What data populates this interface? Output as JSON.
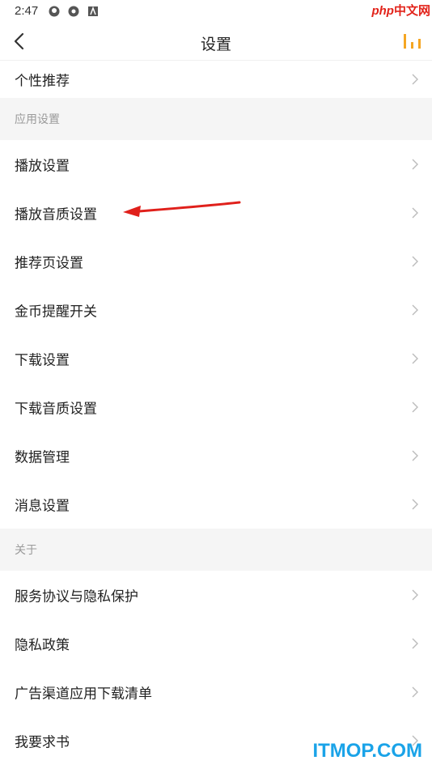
{
  "status_bar": {
    "time": "2:47",
    "icons": [
      "tencent-icon",
      "camera-aperture-icon",
      "a-box-icon"
    ]
  },
  "watermark_top": {
    "php": "php",
    "cn": "中文网"
  },
  "header": {
    "title": "设置",
    "back_icon": "chevron-left-icon",
    "right_icon": "equalizer-icon"
  },
  "list": {
    "top_item": "个性推荐",
    "section_app": "应用设置",
    "app_items": [
      "播放设置",
      "播放音质设置",
      "推荐页设置",
      "金币提醒开关",
      "下载设置",
      "下载音质设置",
      "数据管理",
      "消息设置"
    ],
    "section_about": "关于",
    "about_items": [
      "服务协议与隐私保护",
      "隐私政策",
      "广告渠道应用下载清单",
      "我要求书"
    ]
  },
  "watermark_bottom": "ITMOP.COM",
  "colors": {
    "accent": "#f5a623",
    "section_bg": "#f5f5f5",
    "arrow": "#e0201b",
    "watermark_blue": "#1aa3e8"
  }
}
